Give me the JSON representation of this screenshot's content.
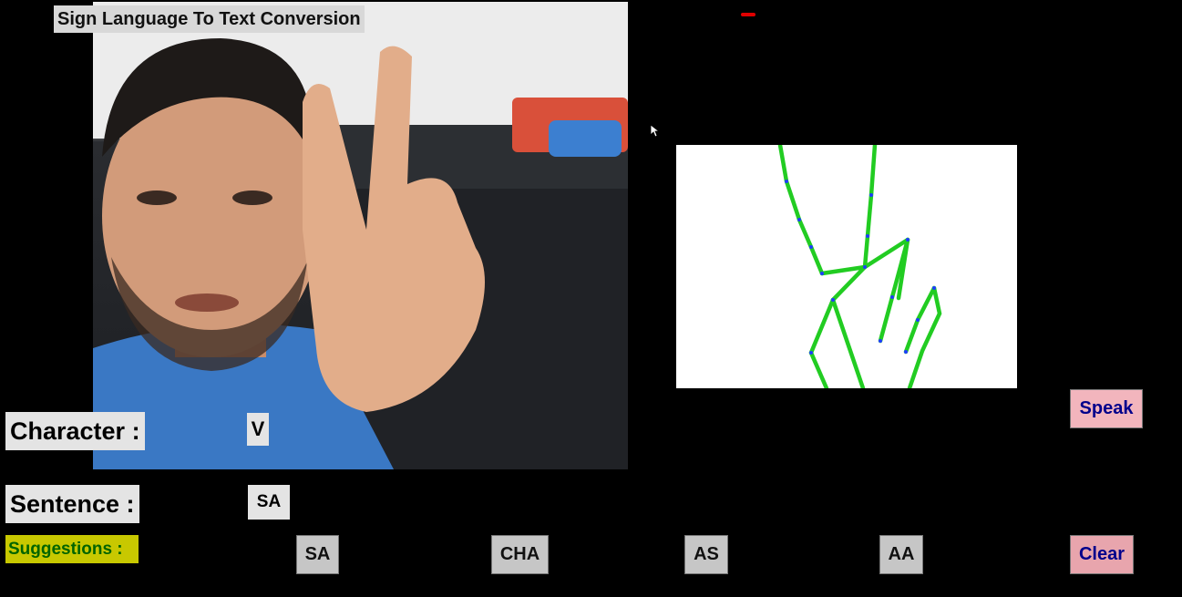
{
  "window": {
    "title": "Sign Language To Text Conversion"
  },
  "character": {
    "label": "Character :",
    "value": "V"
  },
  "sentence": {
    "label": "Sentence :",
    "value": "SA"
  },
  "suggestions": {
    "label": "Suggestions :",
    "items": [
      "SA",
      "CHA",
      "AS",
      "AA"
    ]
  },
  "actions": {
    "speak_label": "Speak",
    "clear_label": "Clear"
  },
  "colors": {
    "background": "#000000",
    "skeleton_line": "#22cc22",
    "skeleton_joint": "#1e3cff",
    "suggestions_label_bg": "#c8c800",
    "button_text": "#00008b"
  }
}
